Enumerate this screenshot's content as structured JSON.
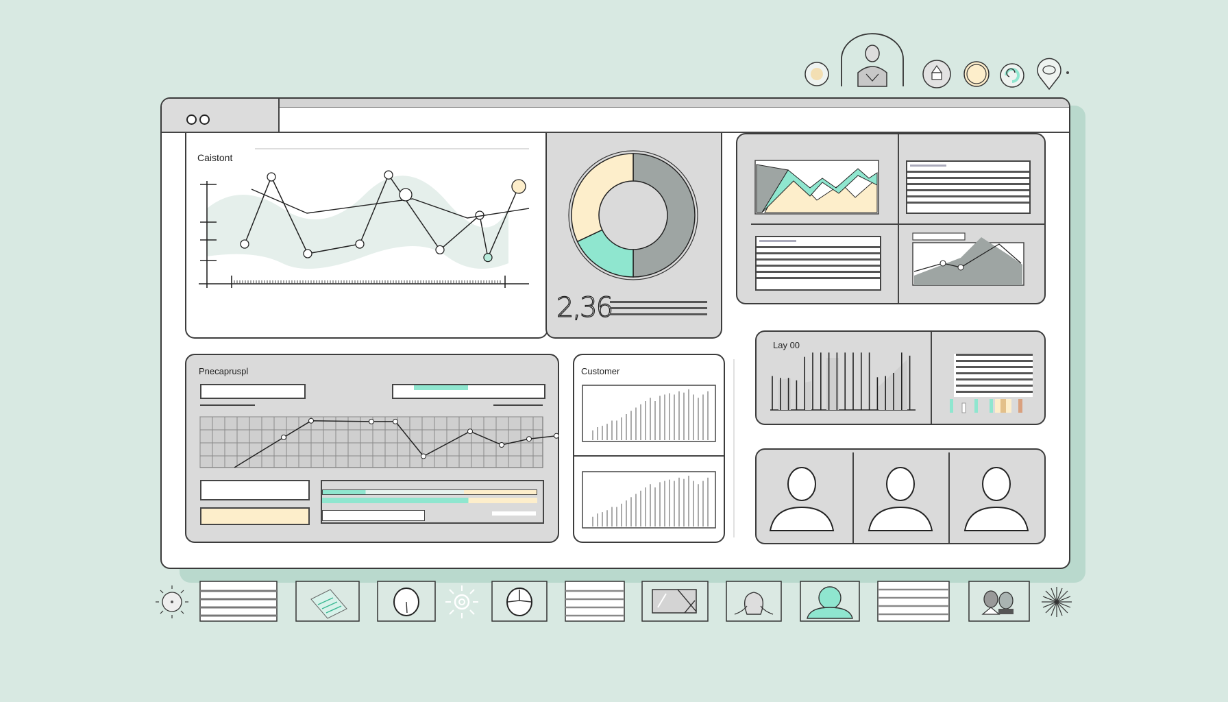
{
  "colors": {
    "background": "#d8e9e2",
    "accent_mint": "#8fe6cf",
    "accent_cream": "#fdeecb",
    "panel_grey": "#dadada",
    "outline": "#3a3a3a",
    "donut_dark": "#9ea5a3"
  },
  "top_icons": [
    {
      "name": "status-dot-icon"
    },
    {
      "name": "user-profile-icon"
    },
    {
      "name": "cupcake-icon"
    },
    {
      "name": "cream-circle-icon"
    },
    {
      "name": "mint-swirl-icon"
    },
    {
      "name": "location-pin-icon"
    }
  ],
  "window": {
    "controls": [
      "dot-1",
      "dot-2"
    ]
  },
  "line_panel": {
    "title": "Caistont"
  },
  "donut_panel": {
    "value": "2,36",
    "segments": [
      {
        "label": "cream",
        "percent": 32,
        "color": "#fdeecb"
      },
      {
        "label": "mint",
        "percent": 18,
        "color": "#8fe6cf"
      },
      {
        "label": "grey",
        "percent": 50,
        "color": "#9ea5a3"
      }
    ]
  },
  "progress_panel": {
    "title": "Pnecapruspl",
    "progress_mint": 0.45
  },
  "customer_panel": {
    "title": "Customer"
  },
  "bar_panel": {
    "title": "Lay 00"
  },
  "users_panel": {
    "users": [
      "user-1",
      "user-2",
      "user-3"
    ]
  },
  "bottom_icons": [
    "sun-dial-icon",
    "list-icon",
    "document-icon",
    "clock-icon",
    "sun-icon",
    "pie-clock-icon",
    "list-icon",
    "image-icon",
    "user-outline-icon",
    "user-mint-icon",
    "list-icon",
    "users-pair-icon",
    "starburst-icon"
  ],
  "chart_data": [
    {
      "type": "line",
      "title": "Caistont",
      "series": [
        {
          "name": "series-a",
          "values": [
            2,
            9,
            1,
            2,
            9.2,
            1.4,
            5,
            0.6,
            8
          ]
        },
        {
          "name": "series-b",
          "values": [
            7,
            4.5,
            6,
            4,
            5
          ]
        }
      ],
      "xlabel": "",
      "ylabel": ""
    },
    {
      "type": "pie",
      "title": "",
      "categories": [
        "cream",
        "mint",
        "grey"
      ],
      "values": [
        32,
        18,
        50
      ],
      "center_label": "2,36"
    },
    {
      "type": "line",
      "title": "Pnecapruspl",
      "values": [
        0,
        4,
        6.2,
        6.1,
        6.1,
        1.5,
        4.8,
        3,
        3.8,
        4.2
      ],
      "grid": true
    },
    {
      "type": "bar",
      "title": "Lay 00",
      "values": [
        5.5,
        5.2,
        5.2,
        4.8,
        8.6,
        9.3,
        9.3,
        9.3,
        9.3,
        9.3,
        9.3,
        9.3,
        9.3,
        5.3,
        5.5,
        6,
        9.3,
        8.8
      ]
    },
    {
      "type": "bar",
      "title": "Customer",
      "values": [
        1.5,
        2,
        2.2,
        2.5,
        3,
        3,
        3.5,
        4,
        4.5,
        5,
        5.5,
        6,
        6.5,
        6,
        6.8,
        7,
        7.2,
        7,
        7.5,
        7.3,
        7.8,
        7,
        6.5,
        7,
        7.5
      ]
    }
  ]
}
